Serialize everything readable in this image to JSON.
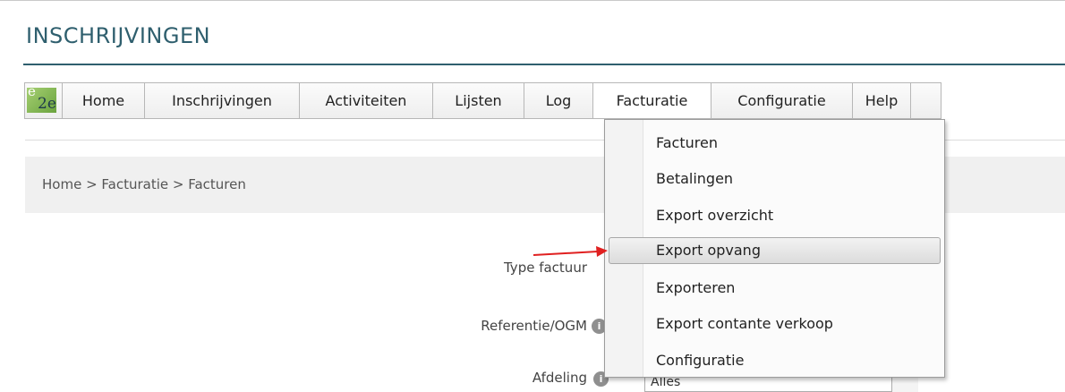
{
  "page": {
    "title": "INSCHRIJVINGEN"
  },
  "logo": {
    "top": "e",
    "bottom": "2e"
  },
  "menu": {
    "items": [
      {
        "label": "Home"
      },
      {
        "label": "Inschrijvingen"
      },
      {
        "label": "Activiteiten"
      },
      {
        "label": "Lijsten"
      },
      {
        "label": "Log"
      },
      {
        "label": "Facturatie"
      },
      {
        "label": "Configuratie"
      },
      {
        "label": "Help"
      }
    ],
    "active": "Facturatie"
  },
  "breadcrumb": {
    "text": "Home > Facturatie > Facturen"
  },
  "form": {
    "type_label": "Type factuur",
    "ref_label": "Referentie/OGM",
    "afdeling_label": "Afdeling",
    "afdeling_value": "Alles"
  },
  "dropdown": {
    "items": [
      {
        "label": "Facturen"
      },
      {
        "label": "Betalingen"
      },
      {
        "label": "Export overzicht"
      },
      {
        "label": "Export opvang"
      },
      {
        "label": "Exporteren"
      },
      {
        "label": "Export contante verkoop"
      },
      {
        "label": "Configuratie"
      }
    ],
    "highlighted": "Export opvang"
  },
  "colors": {
    "accent": "#2f5f6e",
    "annotation_arrow": "#e02020"
  }
}
